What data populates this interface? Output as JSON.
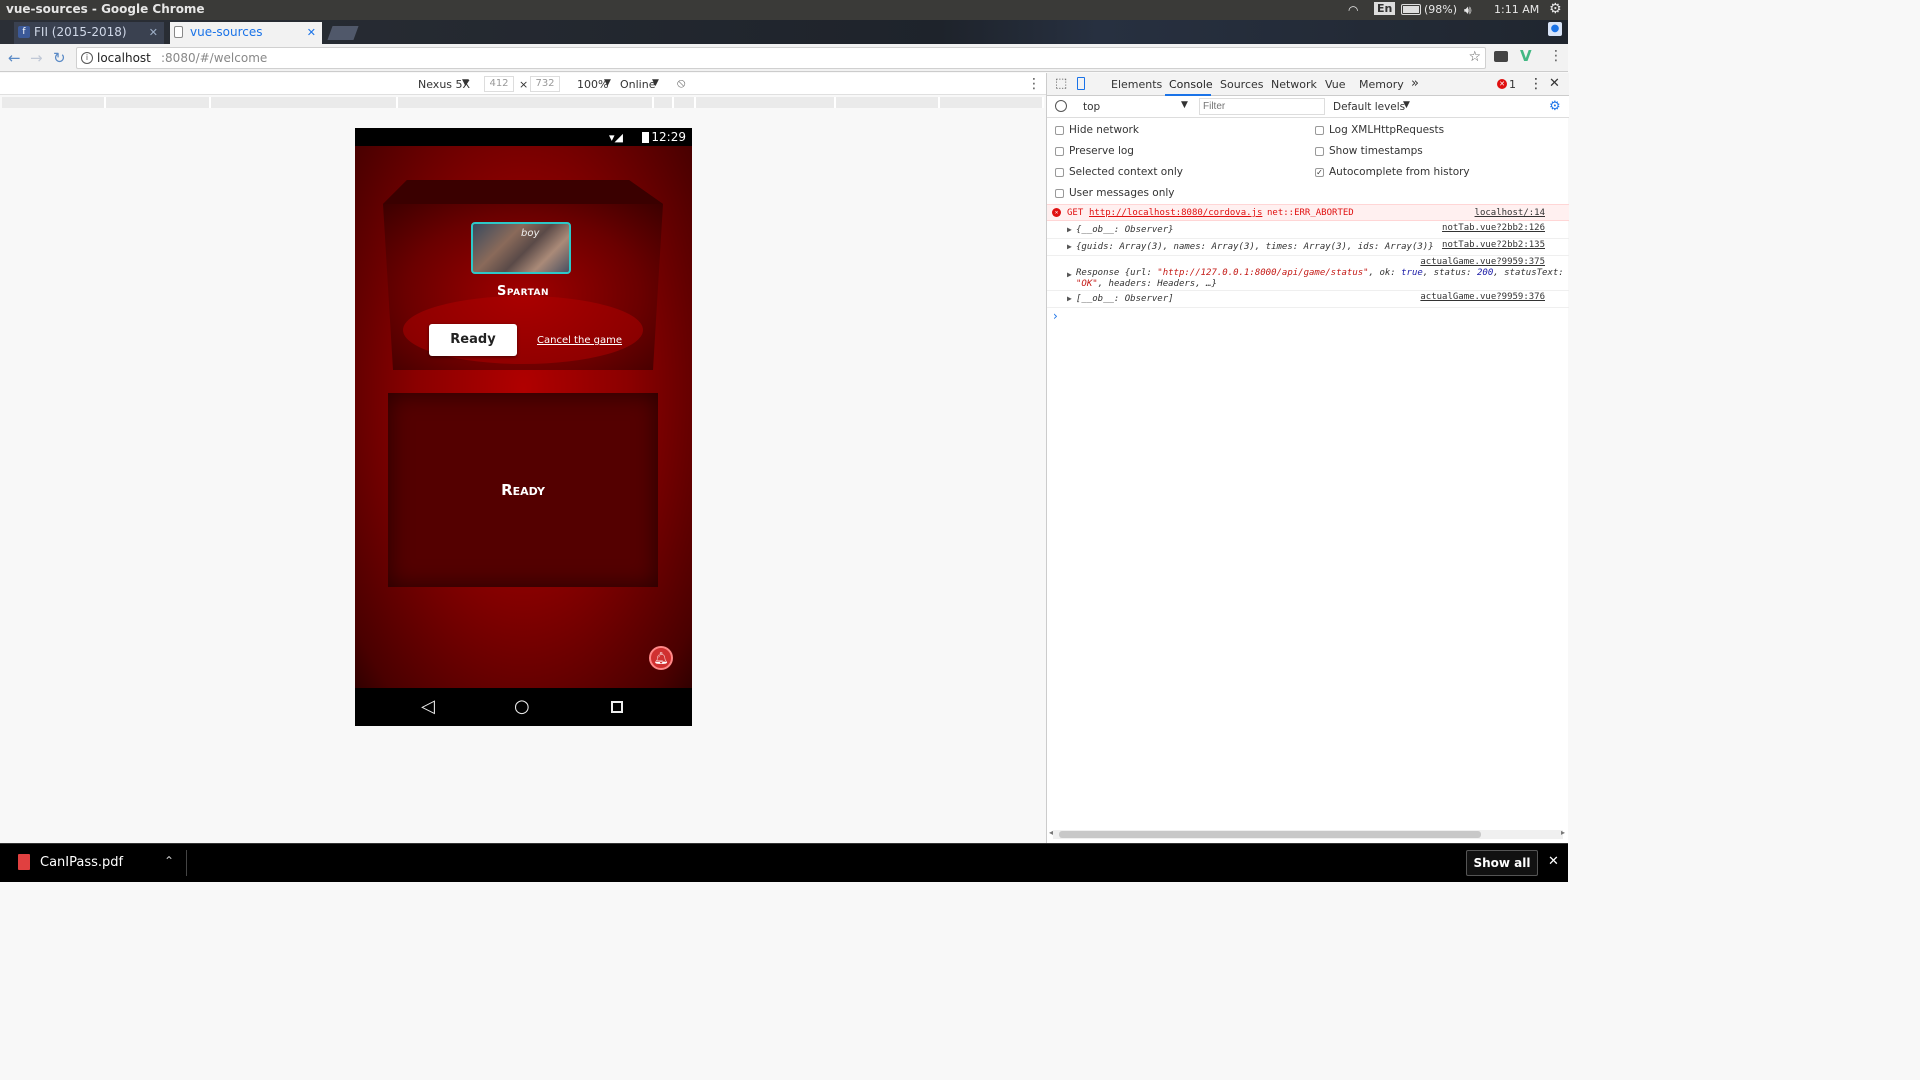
{
  "os": {
    "window_title": "vue-sources - Google Chrome",
    "lang": "En",
    "battery": "(98%)",
    "time": "1:11 AM"
  },
  "tabs": [
    {
      "label": "FII (2015-2018)",
      "active": false
    },
    {
      "label": "vue-sources",
      "active": true
    }
  ],
  "address": {
    "host": "localhost",
    "rest": ":8080/#/welcome"
  },
  "device_toolbar": {
    "device": "Nexus 5X",
    "width": "412",
    "times": "×",
    "height": "732",
    "zoom": "100%",
    "network": "Online"
  },
  "phone": {
    "status_time": "12:29",
    "player_name": "Spartan",
    "avatar_caption": "boy",
    "ready_button": "Ready",
    "cancel_link": "Cancel the game",
    "panel_label": "Ready"
  },
  "devtools": {
    "tabs": [
      "Elements",
      "Console",
      "Sources",
      "Network",
      "Vue",
      "Memory"
    ],
    "active_tab": "Console",
    "more": "»",
    "error_count": "1",
    "context": "top",
    "filter_placeholder": "Filter",
    "levels": "Default levels",
    "options_left": [
      {
        "label": "Hide network",
        "checked": false
      },
      {
        "label": "Preserve log",
        "checked": false
      },
      {
        "label": "Selected context only",
        "checked": false
      },
      {
        "label": "User messages only",
        "checked": false
      }
    ],
    "options_right": [
      {
        "label": "Log XMLHttpRequests",
        "checked": false
      },
      {
        "label": "Show timestamps",
        "checked": false
      },
      {
        "label": "Autocomplete from history",
        "checked": true
      }
    ],
    "console": {
      "error": {
        "method": "GET",
        "url": "http://localhost:8080/cordova.js",
        "msg": "net::ERR_ABORTED",
        "source": "localhost/:14"
      },
      "lines": [
        {
          "text": "{__ob__: Observer}",
          "source": "notTab.vue?2bb2:126"
        },
        {
          "text": "{guids: Array(3), names: Array(3), times: Array(3), ids: Array(3)}",
          "source": "notTab.vue?2bb2:135"
        },
        {
          "source": "actualGame.vue?9959:375"
        },
        {
          "text": "[__ob__: Observer]",
          "source": "actualGame.vue?9959:376"
        }
      ],
      "response_prefix": "Response {url: ",
      "response_url": "\"http://127.0.0.1:8000/api/game/status\"",
      "response_ok_key": ", ok: ",
      "response_ok_val": "true",
      "response_status_key": ", status: ",
      "response_status_val": "200",
      "response_st_key": ", statusText:",
      "response_line2_val": "\"OK\"",
      "response_line2_rest": ", headers: Headers, …}",
      "prompt": "›"
    }
  },
  "download": {
    "file": "CanIPass.pdf",
    "show_all": "Show all"
  },
  "colors": {
    "accent": "#1a73e8",
    "error": "#e01010",
    "phone_red": "#b00000"
  }
}
